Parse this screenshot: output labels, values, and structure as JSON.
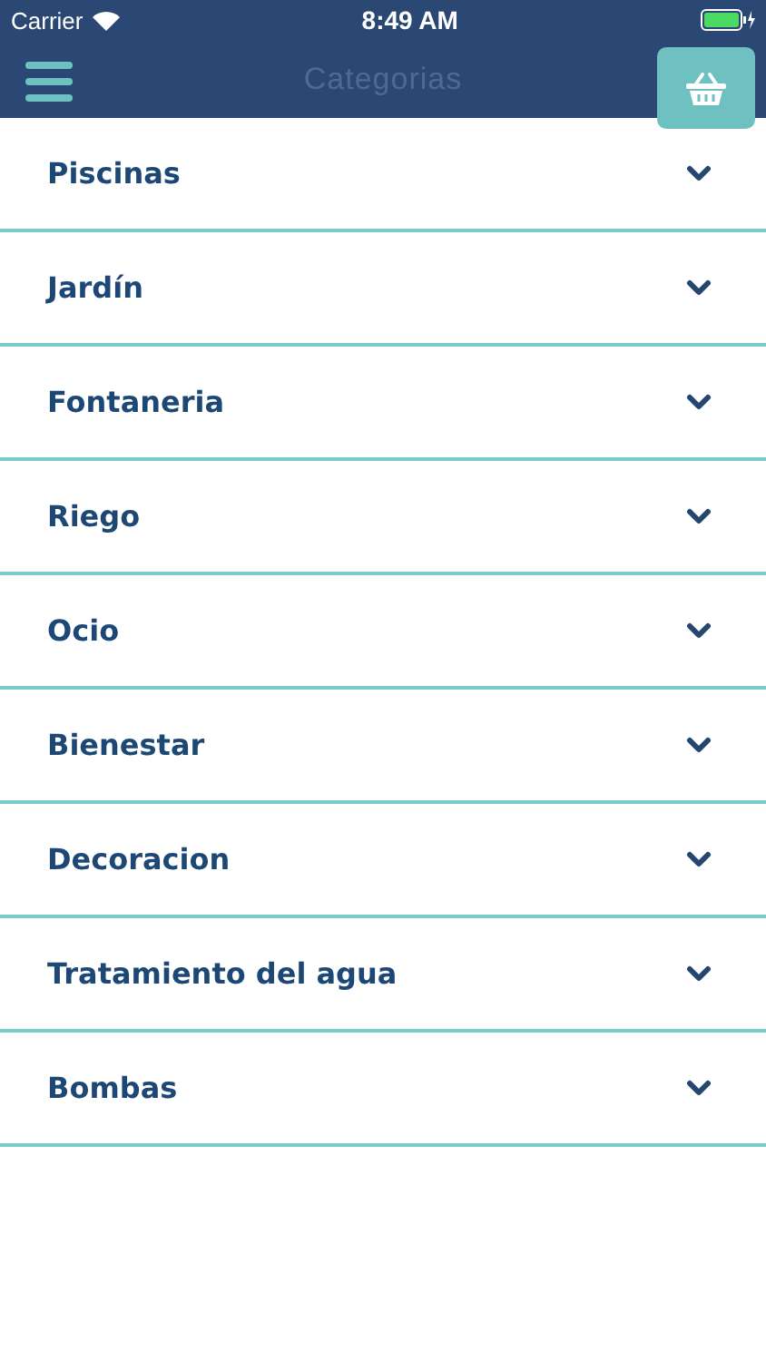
{
  "status_bar": {
    "carrier": "Carrier",
    "time": "8:49 AM"
  },
  "nav_bar": {
    "title": "Categorias"
  },
  "categories": [
    {
      "label": "Piscinas",
      "expanded": false
    },
    {
      "label": "Jardín",
      "expanded": false
    },
    {
      "label": "Fontaneria",
      "expanded": false
    },
    {
      "label": "Riego",
      "expanded": false
    },
    {
      "label": "Ocio",
      "expanded": false
    },
    {
      "label": "Bienestar",
      "expanded": false
    },
    {
      "label": "Decoracion",
      "expanded": false
    },
    {
      "label": "Tratamiento del agua",
      "expanded": false
    },
    {
      "label": "Bombas",
      "expanded": false
    }
  ]
}
